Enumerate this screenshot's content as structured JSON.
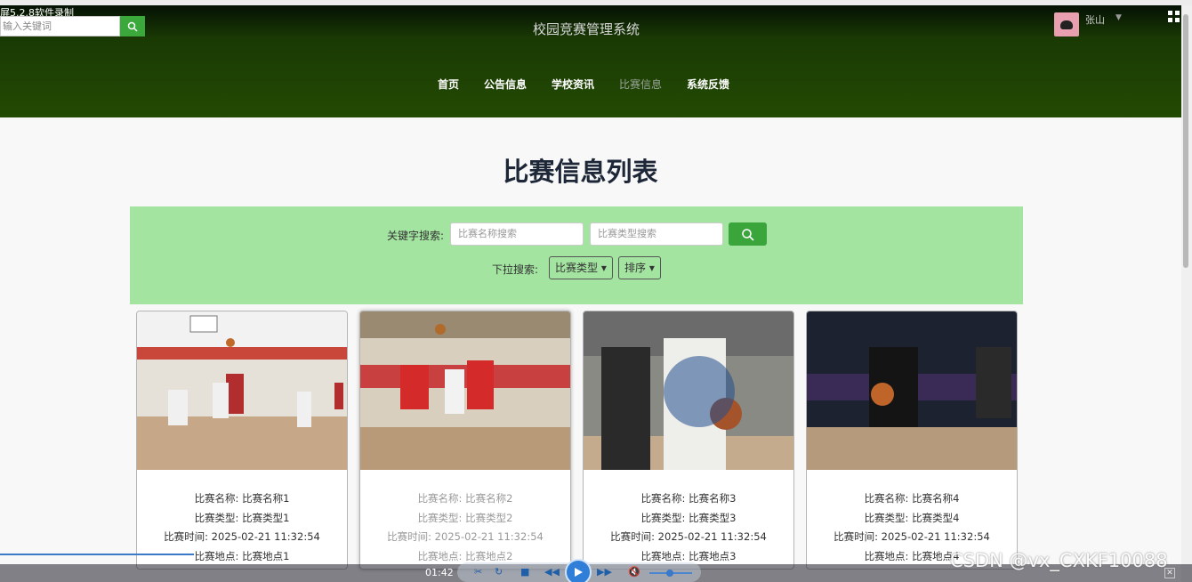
{
  "recorder": {
    "label": "屏5.2.8软件录制"
  },
  "top_search": {
    "placeholder": "输入关键词"
  },
  "site": {
    "title": "校园竞赛管理系统"
  },
  "user": {
    "name": "张山"
  },
  "nav": {
    "items": [
      {
        "label": "首页",
        "active": false
      },
      {
        "label": "公告信息",
        "active": false
      },
      {
        "label": "学校资讯",
        "active": false
      },
      {
        "label": "比赛信息",
        "active": true
      },
      {
        "label": "系统反馈",
        "active": false
      }
    ]
  },
  "page": {
    "heading": "比赛信息列表"
  },
  "filter": {
    "keyword_label": "关键字搜索:",
    "name_placeholder": "比赛名称搜索",
    "type_placeholder": "比赛类型搜索",
    "dropdown_label": "下拉搜索:",
    "type_dropdown": "比赛类型",
    "sort_dropdown": "排序"
  },
  "cards": [
    {
      "name": "比赛名称: 比赛名称1",
      "type": "比赛类型: 比赛类型1",
      "time": "比赛时间: 2025-02-21 11:32:54",
      "place": "比赛地点: 比赛地点1"
    },
    {
      "name": "比赛名称: 比赛名称2",
      "type": "比赛类型: 比赛类型2",
      "time": "比赛时间: 2025-02-21 11:32:54",
      "place": "比赛地点: 比赛地点2"
    },
    {
      "name": "比赛名称: 比赛名称3",
      "type": "比赛类型: 比赛类型3",
      "time": "比赛时间: 2025-02-21 11:32:54",
      "place": "比赛地点: 比赛地点3"
    },
    {
      "name": "比赛名称: 比赛名称4",
      "type": "比赛类型: 比赛类型4",
      "time": "比赛时间: 2025-02-21 11:32:54",
      "place": "比赛地点: 比赛地点4"
    }
  ],
  "player": {
    "time": "01:42"
  },
  "watermark": "CSDN @vx_CXKF10088",
  "colors": {
    "header_green": "#234a03",
    "filter_green": "#a3e4a0",
    "button_green": "#39a53a"
  }
}
